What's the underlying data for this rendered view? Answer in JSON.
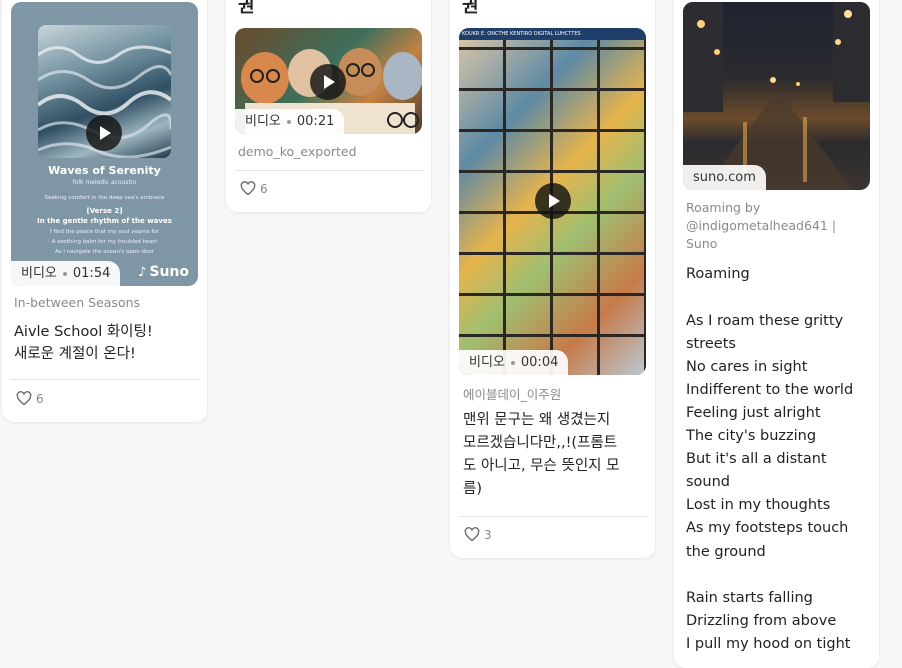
{
  "cards": [
    {
      "art_title": "Waves of Serenity",
      "art_subtitle": "folk melodic acoustin",
      "art_lines": [
        "Seeking comfort in the deep sea's embrace",
        "[Verse 2]",
        "In the gentle rhythm of the waves",
        "I find the peace that my soul yearns for",
        "A soothing balm for my troubled heart",
        "As I navigate the ocean's open door"
      ],
      "badge_type": "비디오",
      "duration": "01:54",
      "brand": "Suno",
      "author": "In-between Seasons",
      "title_lines": [
        "Aivle School 화이팅!",
        "새로운 계절이 온다!"
      ],
      "likes": "6"
    },
    {
      "heading": "권",
      "badge_type": "비디오",
      "duration": "00:21",
      "author": "demo_ko_exported",
      "likes": "6"
    },
    {
      "heading": "권",
      "art_banner": "KOUKR E. ONCTHE KENTIRO DIGITAL LUHCTTES",
      "badge_type": "비디오",
      "duration": "00:04",
      "author": "에이블데이_이주원",
      "title_lines": [
        "맨위 문구는 왜 생겼는지",
        "모르겠습니다만,,!(프롬트",
        "도 아니고, 무슨 뜻인지 모",
        "름)"
      ],
      "likes": "3"
    },
    {
      "source": "suno.com",
      "caption_lines": [
        "Roaming by",
        "@indigometalhead641 |",
        "Suno"
      ],
      "lyrics": [
        "Roaming",
        "",
        "As I roam these gritty",
        "streets",
        "No cares in sight",
        "Indifferent to the world",
        "Feeling just alright",
        "The city's buzzing",
        "But it's all a distant",
        "sound",
        "Lost in my thoughts",
        "As my footsteps touch",
        "the ground",
        "",
        "Rain starts falling",
        "Drizzling from above",
        "I pull my hood on tight"
      ]
    }
  ]
}
